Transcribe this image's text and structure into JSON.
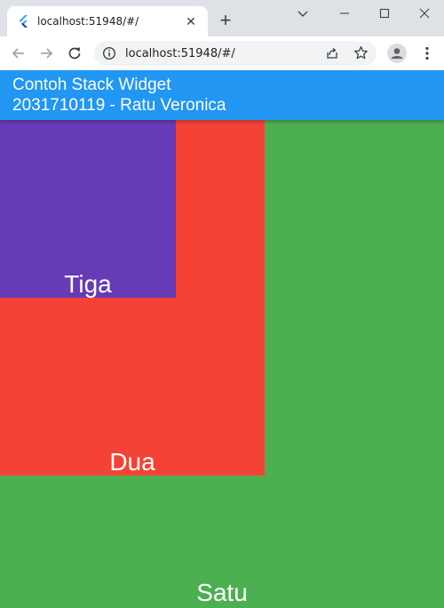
{
  "browser": {
    "tab_title": "localhost:51948/#/",
    "url": "localhost:51948/#/",
    "new_tab_glyph": "+",
    "close_glyph": "✕"
  },
  "app": {
    "title_line1": "Contoh Stack Widget",
    "title_line2": "2031710119 - Ratu Veronica",
    "appbar_color": "#2196f3"
  },
  "stack": {
    "boxes": [
      {
        "label": "Satu",
        "color": "#4caf50"
      },
      {
        "label": "Dua",
        "color": "#f44336"
      },
      {
        "label": "Tiga",
        "color": "#673ab7"
      }
    ]
  },
  "icons": {
    "favicon": "flutter-icon",
    "back": "arrow-left-icon",
    "forward": "arrow-right-icon",
    "reload": "reload-icon",
    "info": "info-icon",
    "share": "share-icon",
    "bookmark": "star-icon",
    "profile": "person-icon",
    "menu": "kebab-menu-icon"
  }
}
